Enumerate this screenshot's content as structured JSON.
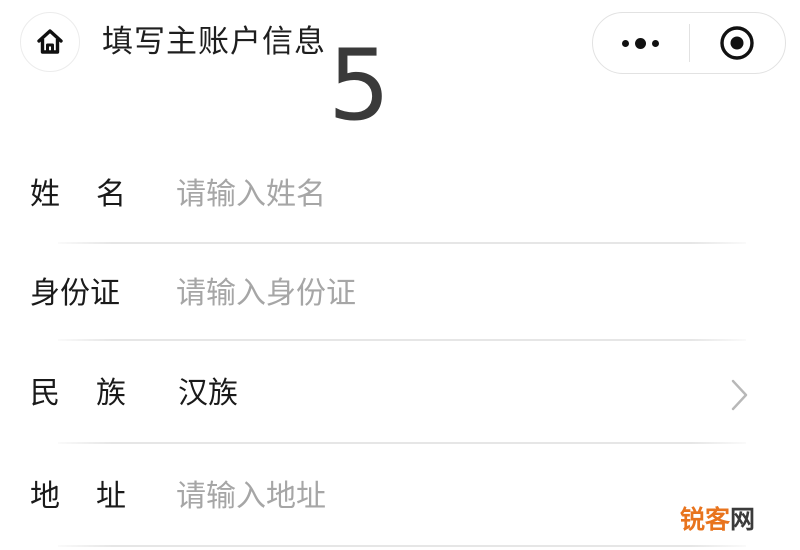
{
  "header": {
    "title": "填写主账户信息",
    "home_icon": "home-icon",
    "more_icon": "more-dots-icon",
    "close_icon": "target-circle-icon"
  },
  "step_number": "5",
  "form": {
    "name": {
      "label_chars": [
        "姓",
        "名"
      ],
      "placeholder": "请输入姓名"
    },
    "id_card": {
      "label": "身份证",
      "placeholder": "请输入身份证"
    },
    "ethnicity": {
      "label_chars": [
        "民",
        "族"
      ],
      "value": "汉族"
    },
    "address": {
      "label_chars": [
        "地",
        "址"
      ],
      "placeholder": "请输入地址"
    }
  },
  "watermark": {
    "main": "锐客",
    "last": "网"
  },
  "colors": {
    "text": "#1a1a1a",
    "placeholder": "#a6a6a6",
    "divider": "#e6e6e6",
    "watermark": "#e8741e"
  }
}
